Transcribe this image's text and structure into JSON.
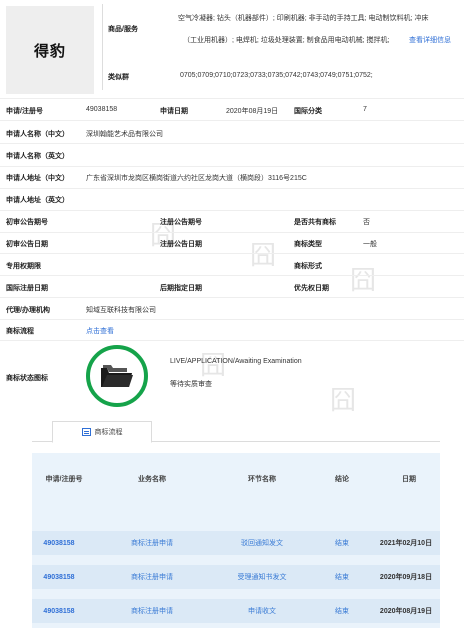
{
  "logo": {
    "text": "得豹"
  },
  "goods": {
    "label": "商品/服务",
    "line1": "空气冷凝器; 钻头（机器部件）; 印刷机器; 非手动的手持工具; 电动制饮料机; 冲床",
    "line2": "（工业用机器）; 电焊机; 垃圾处理装置; 制食品用电动机械; 搅拌机;",
    "more_link": "查看详细信息"
  },
  "similar_group": {
    "label": "类似群",
    "value": "0705;0709;0710;0723;0733;0735;0742;0743;0749;0751;0752;"
  },
  "fields": {
    "reg_no_label": "申请/注册号",
    "reg_no": "49038158",
    "apply_date_label": "申请日期",
    "apply_date": "2020年08月19日",
    "intl_class_label": "国际分类",
    "intl_class": "7",
    "applicant_cn_label": "申请人名称（中文）",
    "applicant_cn": "深圳翰能艺术品有限公司",
    "applicant_en_label": "申请人名称（英文）",
    "applicant_en": "",
    "address_cn_label": "申请人地址（中文）",
    "address_cn": "广东省深圳市龙岗区横岗街道六约社区龙岗大道（横岗段）3116号215C",
    "address_en_label": "申请人地址（英文）",
    "address_en": "",
    "prelim_no_label": "初审公告期号",
    "prelim_no": "",
    "reg_pub_no_label": "注册公告期号",
    "reg_pub_no": "",
    "shared_label": "是否共有商标",
    "shared": "否",
    "prelim_date_label": "初审公告日期",
    "prelim_date": "",
    "reg_pub_date_label": "注册公告日期",
    "reg_pub_date": "",
    "tm_type_label": "商标类型",
    "tm_type": "一般",
    "exclusive_label": "专用权期限",
    "exclusive": "",
    "tm_form_label": "商标形式",
    "tm_form": "",
    "intl_reg_date_label": "国际注册日期",
    "intl_reg_date": "",
    "later_date_label": "后期指定日期",
    "later_date": "",
    "priority_label": "优先权日期",
    "priority": "",
    "agent_label": "代理/办理机构",
    "agent": "知域互联科技有限公司",
    "flow_label": "商标流程",
    "flow_link": "点击查看",
    "status_label": "商标状态图标",
    "status_en": "LIVE/APPLICATION/Awaiting Examination",
    "status_cn": "等待实质审查"
  },
  "flow_tab": {
    "label": "商标流程"
  },
  "flow_table": {
    "headers": [
      "申请/注册号",
      "业务名称",
      "环节名称",
      "结论",
      "日期"
    ],
    "rows": [
      {
        "reg_no": "49038158",
        "business": "商标注册申请",
        "step": "驳回通知发文",
        "result": "结束",
        "date": "2021年02月10日"
      },
      {
        "reg_no": "49038158",
        "business": "商标注册申请",
        "step": "受理通知书发文",
        "result": "结束",
        "date": "2020年09月18日"
      },
      {
        "reg_no": "49038158",
        "business": "商标注册申请",
        "step": "申请收文",
        "result": "结束",
        "date": "2020年08月19日"
      }
    ]
  },
  "colors": {
    "accent": "#2f6fd6",
    "status_green": "#15a34a",
    "table_bg": "#eaf3fb",
    "row_bg": "#dbe9f6"
  }
}
